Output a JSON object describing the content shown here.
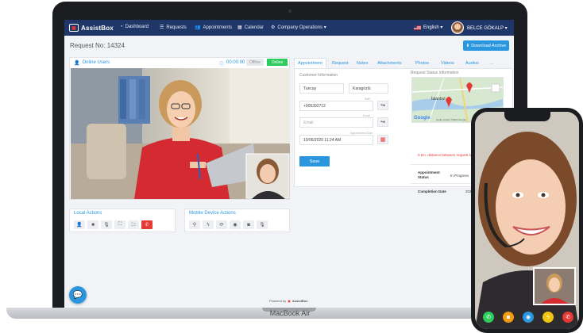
{
  "app": {
    "logo": "AssistBox",
    "nav": [
      {
        "label": "Dashboard",
        "icon": "dashboard-icon"
      },
      {
        "label": "Requests",
        "icon": "list-icon"
      },
      {
        "label": "Appointments",
        "icon": "users-icon"
      },
      {
        "label": "Calendar",
        "icon": "calendar-icon"
      },
      {
        "label": "Company Operations ▾",
        "icon": "gears-icon"
      }
    ],
    "language": "English ▾",
    "user": "BELCE GÖKALP ▾"
  },
  "request": {
    "title": "Request No: 14324",
    "download_label": "Download Archive"
  },
  "call": {
    "online_label": "Online Users",
    "timer": "00:00:00",
    "status_offline": "Offline",
    "status_online": "Online"
  },
  "local_actions": {
    "title": "Local Actions",
    "icons": [
      "user-icon",
      "video-icon",
      "microphone-icon",
      "fullscreen-icon",
      "folder-icon",
      "end-call-icon"
    ]
  },
  "mobile_actions": {
    "title": "Mobile Device Actions",
    "icons": [
      "location-icon",
      "flash-icon",
      "switch-camera-icon",
      "eye-icon",
      "camera-icon",
      "microphone-icon"
    ]
  },
  "tabs": [
    "Appointment",
    "Request",
    "Notes",
    "Attachments",
    "Photos",
    "Videos",
    "Audios",
    "..."
  ],
  "form": {
    "section": "Customer Information",
    "first_name": "Tuncay",
    "last_name": "Karagözlü",
    "phone_caption": "SMS",
    "phone": "+905392712",
    "email_caption": "Email",
    "email_placeholder": "Email",
    "date_caption": "Appointment Date",
    "date": "10/06/2020 11:24 AM",
    "save_label": "Save"
  },
  "location": {
    "section": "Request Status Information",
    "city": "İstanbul",
    "map_brand": "Google",
    "map_footer": "Harita verileri ©2020 Google",
    "warning": "0 km. distance between request location of mobile device."
  },
  "status": {
    "appointment_status_key": "Appointment Status",
    "appointment_status_val": "In Progress",
    "completion_date_key": "Completion Date",
    "completion_date_val": "2020-10"
  },
  "footer": {
    "powered_by": "Powered by",
    "brand": "AssistBox"
  },
  "device": {
    "label": "MacBook Air"
  },
  "colors": {
    "navbar": "#1f3668",
    "accent": "#2b96e0",
    "online": "#2ecc5c",
    "danger": "#e53935"
  }
}
